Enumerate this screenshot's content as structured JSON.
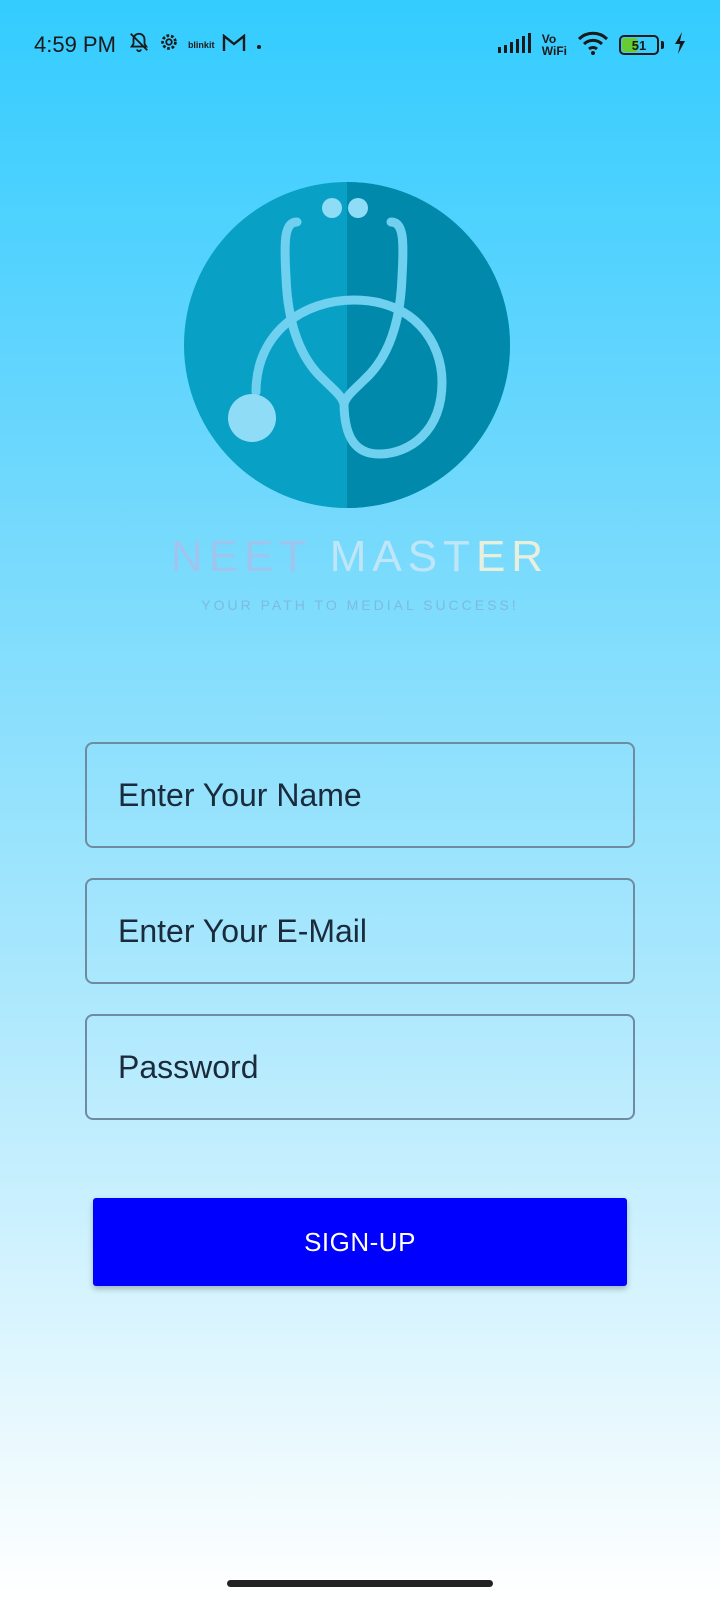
{
  "status_bar": {
    "time": "4:59 PM",
    "icons_left": [
      "bell-off-icon",
      "gear-icon",
      "blinkit-icon",
      "gmail-icon",
      "dot-icon"
    ],
    "blinkit_label": "blinkit",
    "vo_label": "Vo",
    "wifi_label": "WiFi",
    "battery_level": "51",
    "battery_percent": 51
  },
  "brand": {
    "title_part1": "NEET ",
    "title_part2": "MAST",
    "title_part3": "ER",
    "tagline": "YOUR PATH TO MEDIAL SUCCESS!"
  },
  "form": {
    "name_placeholder": "Enter Your Name",
    "email_placeholder": "Enter Your E-Mail",
    "password_placeholder": "Password",
    "signup_label": "SIGN-UP"
  },
  "colors": {
    "primary_button": "#0000ff",
    "background_top": "#33ccff",
    "logo_circle": "#08a0c4"
  }
}
